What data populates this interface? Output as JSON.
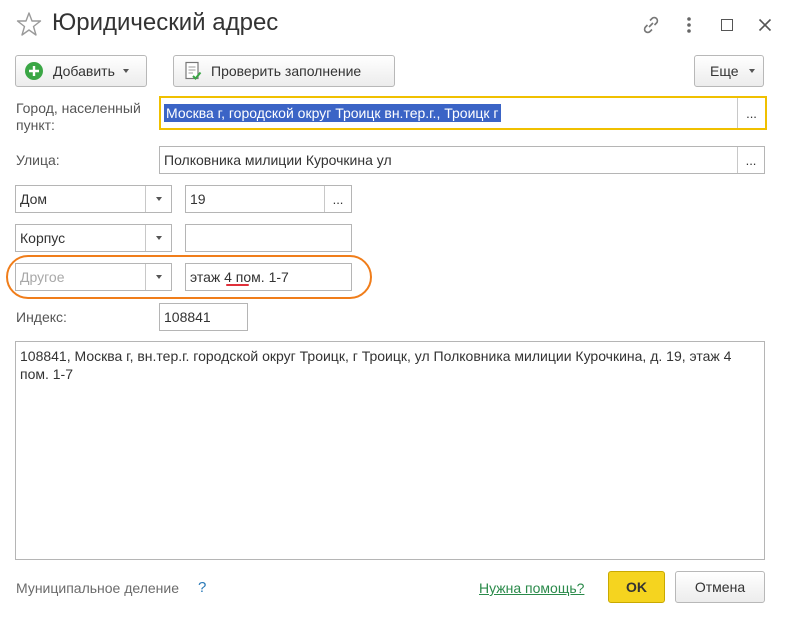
{
  "window": {
    "title": "Юридический адрес"
  },
  "toolbar": {
    "add_label": "Добавить",
    "check_label": "Проверить заполнение",
    "more_label": "Еще"
  },
  "form": {
    "city_label": "Город, населенный пункт:",
    "city_value": "Москва г, городской округ Троицк вн.тер.г., Троицк г",
    "street_label": "Улица:",
    "street_value": "Полковника милиции Курочкина ул",
    "house_type": "Дом",
    "house_value": "19",
    "building_type": "Корпус",
    "building_value": "",
    "other_type_placeholder": "Другое",
    "other_value": "этаж 4 пом. 1-7",
    "index_label": "Индекс:",
    "index_value": "108841",
    "full_address": "108841, Москва г, вн.тер.г. городской округ Троицк, г Троицк, ул Полковника милиции Курочкина, д. 19, этаж 4 пом. 1-7",
    "dots": "..."
  },
  "footer": {
    "municipal_label": "Муниципальное деление",
    "municipal_help": "?",
    "help_link": "Нужна помощь?",
    "ok_label": "OK",
    "cancel_label": "Отмена"
  },
  "colors": {
    "accent_yellow": "#f5d41f",
    "focus_border": "#f0c000",
    "highlight_annotation": "#f07d1a",
    "selection_bg": "#3b64c6",
    "link_green": "#2a8a4a",
    "spell_underline": "#e0303a"
  }
}
